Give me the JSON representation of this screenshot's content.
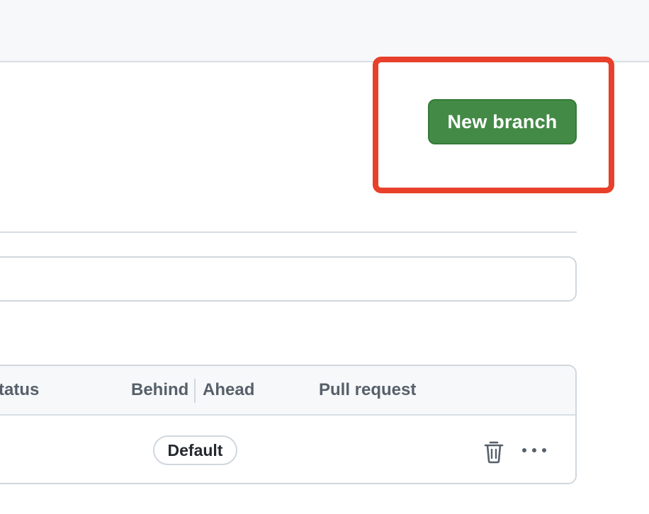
{
  "header": {
    "new_branch_label": "New branch"
  },
  "table": {
    "columns": {
      "status": "Status",
      "behind": "Behind",
      "ahead": "Ahead",
      "pull_request": "Pull request"
    },
    "rows": [
      {
        "badge": "Default",
        "actions": [
          "trash-icon",
          "more-icon"
        ]
      }
    ]
  },
  "colors": {
    "primary_button": "#438a46",
    "highlight": "#e8402a"
  }
}
